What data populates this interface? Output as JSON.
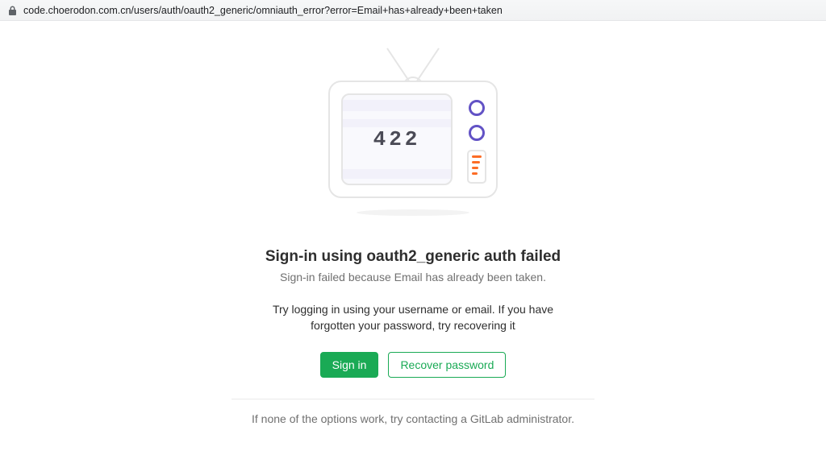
{
  "browser": {
    "url": "code.choerodon.com.cn/users/auth/oauth2_generic/omniauth_error?error=Email+has+already+been+taken"
  },
  "error": {
    "code": "422",
    "heading": "Sign-in using oauth2_generic auth failed",
    "description": "Sign-in failed because Email has already been taken.",
    "help": "Try logging in using your username or email. If you have forgotten your password, try recovering it",
    "footer": "If none of the options work, try contacting a GitLab administrator."
  },
  "buttons": {
    "sign_in": "Sign in",
    "recover": "Recover password"
  }
}
